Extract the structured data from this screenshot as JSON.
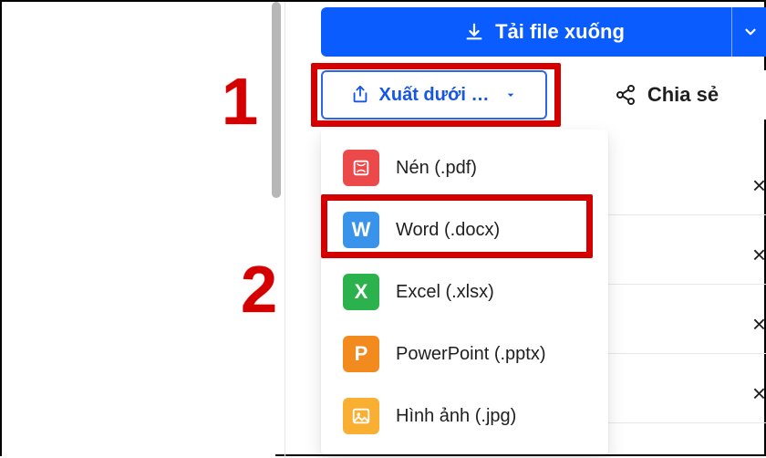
{
  "toolbar": {
    "download_label": "Tải file xuống",
    "export_label": "Xuất dưới …",
    "share_label": "Chia sẻ"
  },
  "menu": {
    "items": [
      {
        "label": "Nén (.pdf)"
      },
      {
        "label": "Word (.docx)"
      },
      {
        "label": "Excel (.xlsx)"
      },
      {
        "label": "PowerPoint (.pptx)"
      },
      {
        "label": "Hình ảnh (.jpg)"
      }
    ]
  },
  "annotations": {
    "step1": "1",
    "step2": "2"
  }
}
